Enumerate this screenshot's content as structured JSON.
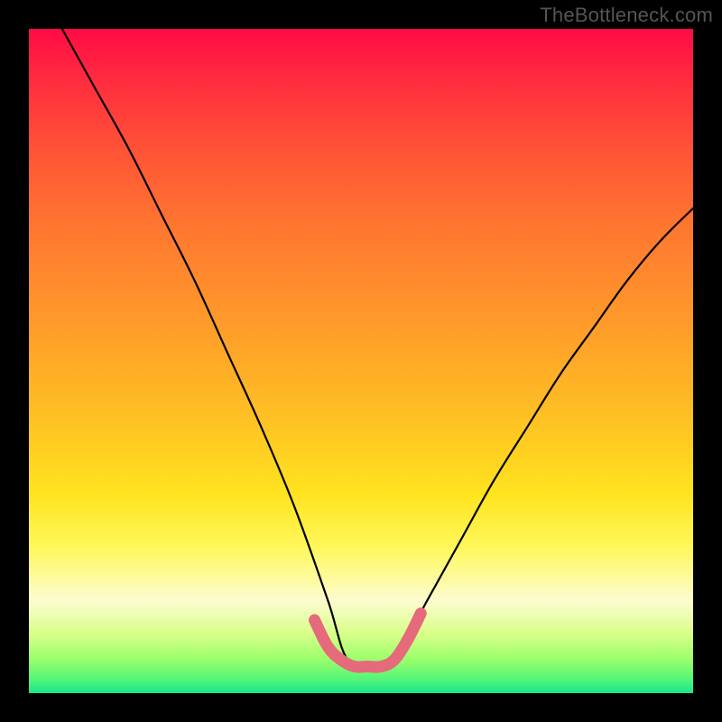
{
  "watermark": "TheBottleneck.com",
  "chart_data": {
    "type": "line",
    "title": "",
    "xlabel": "",
    "ylabel": "",
    "xlim": [
      0,
      100
    ],
    "ylim": [
      0,
      100
    ],
    "grid": false,
    "legend": false,
    "background_gradient": {
      "top_color": "#ff0b45",
      "bottom_color": "#18e58d",
      "description": "vertical red-to-green rainbow gradient"
    },
    "series": [
      {
        "name": "bottleneck-curve",
        "color": "#000000",
        "x": [
          5,
          10,
          15,
          20,
          25,
          30,
          35,
          40,
          45,
          48,
          52,
          55,
          60,
          65,
          70,
          75,
          80,
          85,
          90,
          95,
          100
        ],
        "y": [
          100,
          91,
          82,
          72,
          62,
          51,
          40,
          28,
          14,
          5,
          4,
          5,
          14,
          23,
          32,
          40,
          48,
          55,
          62,
          68,
          73
        ]
      },
      {
        "name": "optimal-region-highlight",
        "color": "#e46a7c",
        "x": [
          43,
          45,
          47,
          49,
          51,
          53,
          55,
          57,
          59
        ],
        "y": [
          11,
          7,
          5,
          4,
          4,
          4,
          5,
          8,
          12
        ]
      }
    ],
    "annotations": []
  }
}
